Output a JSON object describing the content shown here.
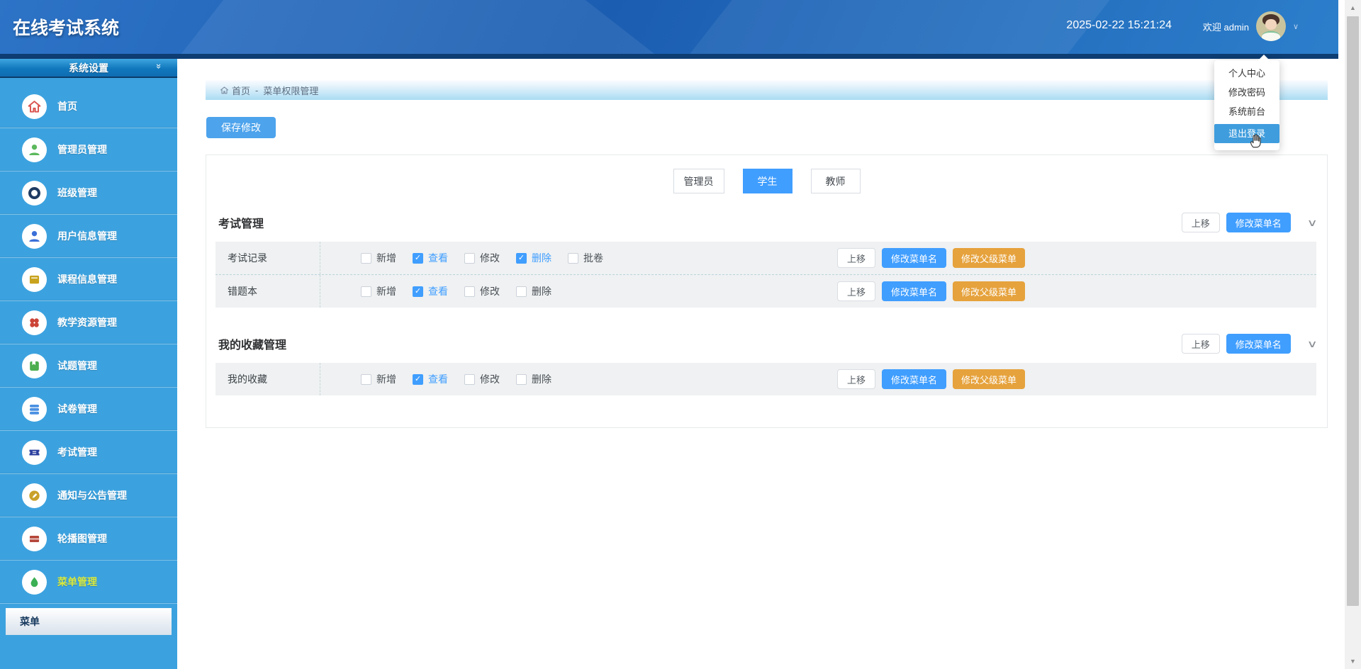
{
  "header": {
    "title": "在线考试系统",
    "datetime": "2025-02-22 15:21:24",
    "welcome": "欢迎 admin"
  },
  "user_menu": {
    "items": [
      {
        "label": "个人中心",
        "active": false
      },
      {
        "label": "修改密码",
        "active": false
      },
      {
        "label": "系统前台",
        "active": false
      },
      {
        "label": "退出登录",
        "active": true
      }
    ]
  },
  "sidebar": {
    "section_title": "系统设置",
    "collapse_icon": "»",
    "items": [
      {
        "label": "首页",
        "icon": "home-icon",
        "icon_color": "#D9534F",
        "active": false
      },
      {
        "label": "管理员管理",
        "icon": "admin-person-icon",
        "icon_color": "#5CB85C",
        "active": false
      },
      {
        "label": "班级管理",
        "icon": "class-ring-icon",
        "icon_color": "#1F3B63",
        "active": false
      },
      {
        "label": "用户信息管理",
        "icon": "user-person-icon",
        "icon_color": "#3A6FD8",
        "active": false
      },
      {
        "label": "课程信息管理",
        "icon": "course-card-icon",
        "icon_color": "#C9A31D",
        "active": false
      },
      {
        "label": "教学资源管理",
        "icon": "resource-clover-icon",
        "icon_color": "#CC4437",
        "active": false
      },
      {
        "label": "试题管理",
        "icon": "question-book-icon",
        "icon_color": "#4CAE4F",
        "active": false
      },
      {
        "label": "试卷管理",
        "icon": "paper-layers-icon",
        "icon_color": "#4A90E2",
        "active": false
      },
      {
        "label": "考试管理",
        "icon": "exam-ticket-icon",
        "icon_color": "#2B3F9E",
        "active": false
      },
      {
        "label": "通知与公告管理",
        "icon": "notice-pencil-icon",
        "icon_color": "#C9A02A",
        "active": false
      },
      {
        "label": "轮播图管理",
        "icon": "carousel-image-icon",
        "icon_color": "#B5483C",
        "active": false
      },
      {
        "label": "菜单管理",
        "icon": "menu-droplet-icon",
        "icon_color": "#3CB054",
        "active": true
      }
    ],
    "submenu_label": "菜单"
  },
  "breadcrumb": {
    "home": "首页",
    "separator": "-",
    "current": "菜单权限管理"
  },
  "toolbar": {
    "save_label": "保存修改"
  },
  "role_tabs": [
    {
      "label": "管理员",
      "active": false
    },
    {
      "label": "学生",
      "active": true
    },
    {
      "label": "教师",
      "active": false
    }
  ],
  "buttons": {
    "move_up": "上移",
    "rename": "修改菜单名",
    "reparent": "修改父级菜单"
  },
  "sections": [
    {
      "title": "考试管理",
      "rows": [
        {
          "name": "考试记录",
          "perms": [
            {
              "label": "新增",
              "checked": false
            },
            {
              "label": "查看",
              "checked": true
            },
            {
              "label": "修改",
              "checked": false
            },
            {
              "label": "删除",
              "checked": true
            },
            {
              "label": "批卷",
              "checked": false
            }
          ]
        },
        {
          "name": "错题本",
          "perms": [
            {
              "label": "新增",
              "checked": false
            },
            {
              "label": "查看",
              "checked": true
            },
            {
              "label": "修改",
              "checked": false
            },
            {
              "label": "删除",
              "checked": false
            }
          ]
        }
      ]
    },
    {
      "title": "我的收藏管理",
      "rows": [
        {
          "name": "我的收藏",
          "perms": [
            {
              "label": "新增",
              "checked": false
            },
            {
              "label": "查看",
              "checked": true
            },
            {
              "label": "修改",
              "checked": false
            },
            {
              "label": "删除",
              "checked": false
            }
          ]
        }
      ]
    }
  ],
  "colors": {
    "accent": "#409EFF",
    "warning": "#E6A23C",
    "sidebar_bg": "#3CA2DF",
    "header_navy": "#0D3D72",
    "active_menu_text": "#D8E93F",
    "checkbox_checked": "#409EFF"
  },
  "scrollbar": {
    "up_icon": "▲",
    "down_icon": "▼"
  },
  "check_glyph": "✓"
}
